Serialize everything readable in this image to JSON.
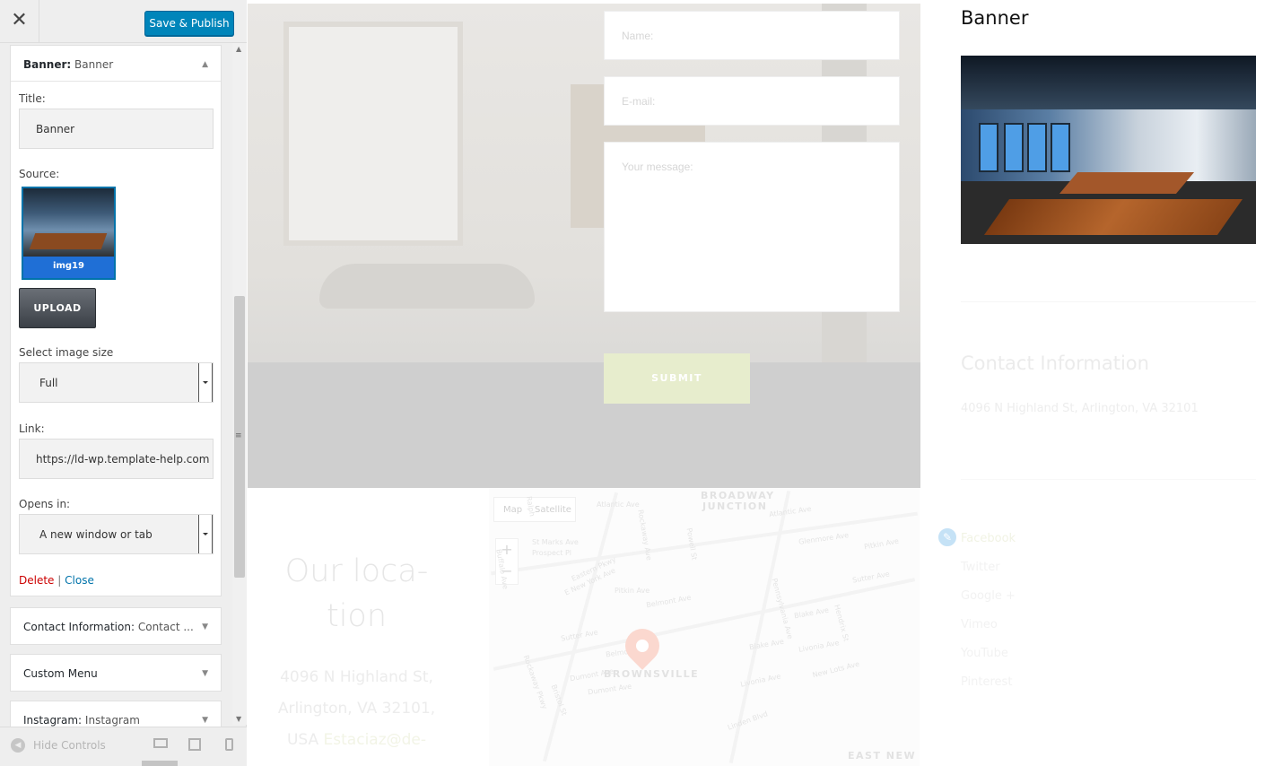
{
  "sidebar": {
    "close_symbol": "✕",
    "publish_label": "Save & Publish",
    "banner_widget": {
      "type_label": "Banner:",
      "name_label": "Banner",
      "title_label": "Title:",
      "title_value": "Banner",
      "source_label": "Source:",
      "image_caption": "img19",
      "upload_label": "UPLOAD",
      "size_label": "Select image size",
      "size_value": "Full",
      "link_label": "Link:",
      "link_value": "https://ld-wp.template-help.com",
      "opens_label": "Opens in:",
      "opens_value": "A new window or tab",
      "delete_label": "Delete",
      "separator": "|",
      "close_label": "Close"
    },
    "other_widgets": [
      {
        "type_label": "Contact Information:",
        "name_label": "Contact ..."
      },
      {
        "type_label": "Custom Menu",
        "name_label": ""
      },
      {
        "type_label": "Instagram:",
        "name_label": "Instagram"
      }
    ],
    "footer": {
      "hide_label": "Hide Controls"
    }
  },
  "preview": {
    "contact_form": {
      "name_placeholder": "Name:",
      "email_placeholder": "E-mail:",
      "message_placeholder": "Your message:",
      "submit_label": "SUBMIT"
    },
    "location": {
      "title_line1": "Our loca-",
      "title_line2": "tion",
      "addr_line1": "4096 N Highland St,",
      "addr_line2": "Arlington, VA 32101,",
      "addr_line3_prefix": "USA",
      "addr_email": "Estaciaz@de-"
    },
    "map": {
      "map_label": "Map",
      "satellite_label": "Satellite",
      "zoom_in": "+",
      "zoom_out": "−",
      "district_top": "BROADWAY",
      "district_top2": "JUNCTION",
      "district_bottom": "BROWNSVILLE",
      "district_east": "EAST NEW",
      "streets": [
        "Atlantic Ave",
        "Atlantic Ave",
        "Glenmore Ave",
        "Pitkin Ave",
        "St Marks Ave",
        "Prospect Pl",
        "Eastern Pkwy",
        "E New York Ave",
        "Pitkin Ave",
        "Belmont Ave",
        "Sutter Ave",
        "Sutter Ave",
        "Blake Ave",
        "Dumont Ave",
        "Livonia Ave",
        "New Lots Ave",
        "Rockaway Ave",
        "Powell St",
        "Pennsylvania Ave",
        "Hendrix St",
        "Ralph",
        "Buffalo Ave",
        "Rockaway Pkwy",
        "Bristol St",
        "Belmont Ave",
        "Dumont Ave",
        "Linden Blvd",
        "Blake Ave",
        "Livonia Ave"
      ]
    },
    "banner": {
      "title": "Banner"
    },
    "contact_info": {
      "title": "Contact Information",
      "address": "4096 N Highland St, Arlington, VA 32101"
    },
    "social": [
      "Facebook",
      "Twitter",
      "Google +",
      "Vimeo",
      "YouTube",
      "Pinterest"
    ]
  },
  "colors": {
    "publish_blue": "#0085ba",
    "thumb_caption_blue": "#1f6fd6",
    "delete_red": "#cc0000",
    "link_blue": "#0073aa",
    "submit_bg": "#e7edcd"
  },
  "icons": {
    "close": "close-icon",
    "collapse": "triangle-up-icon",
    "expand": "triangle-down-icon",
    "hide_controls": "chevron-left-circle-icon",
    "desktop": "desktop-icon",
    "tablet": "tablet-icon",
    "mobile": "mobile-icon",
    "edit": "pencil-icon",
    "map_pin": "map-pin-icon"
  }
}
